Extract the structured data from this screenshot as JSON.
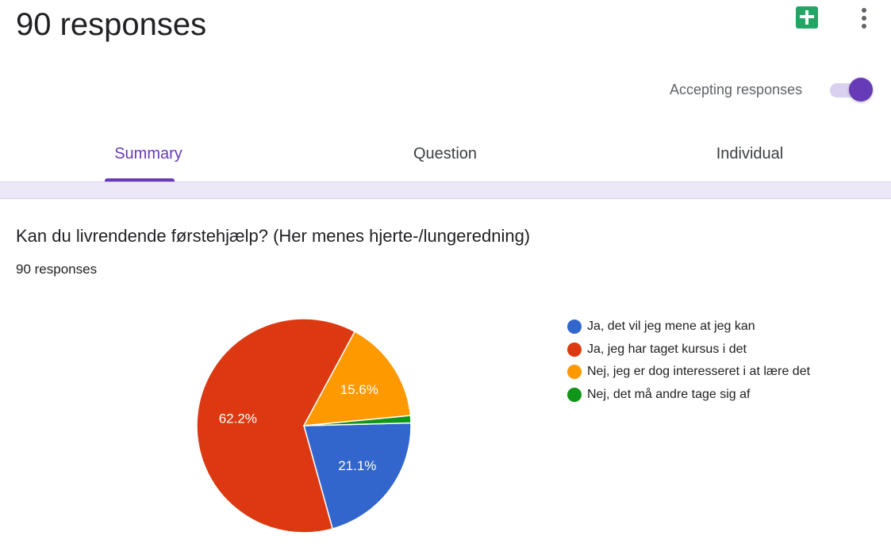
{
  "header": {
    "title": "90 responses",
    "sheets_icon": "google-sheets-icon",
    "more_icon": "more-vert-icon"
  },
  "accepting": {
    "label": "Accepting responses",
    "enabled": true
  },
  "tabs": [
    {
      "label": "Summary",
      "active": true
    },
    {
      "label": "Question",
      "active": false
    },
    {
      "label": "Individual",
      "active": false
    }
  ],
  "question": {
    "title": "Kan du livrendende førstehjælp? (Her menes hjerte-/lungeredning)",
    "response_count": "90 responses"
  },
  "colors": {
    "accent": "#673ab7"
  },
  "chart_data": {
    "type": "pie",
    "series": [
      {
        "label": "Ja, det vil jeg mene at jeg kan",
        "value": 21.1,
        "display": "21.1%",
        "color": "#3366cc"
      },
      {
        "label": "Ja, jeg har taget kursus i det",
        "value": 62.2,
        "display": "62.2%",
        "color": "#dc3912"
      },
      {
        "label": "Nej, jeg er dog interesseret i at lære det",
        "value": 15.6,
        "display": "15.6%",
        "color": "#ff9900"
      },
      {
        "label": "Nej, det må andre tage sig af",
        "value": 1.1,
        "display": "",
        "color": "#109618"
      }
    ],
    "legend_position": "right"
  }
}
